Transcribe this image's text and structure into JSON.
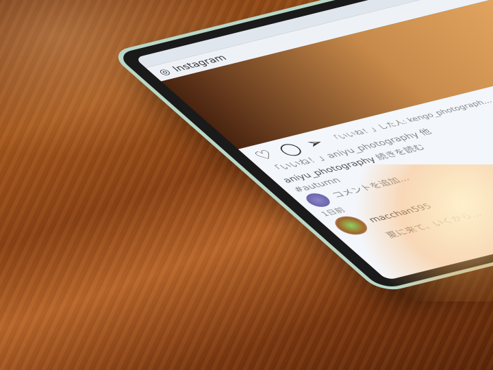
{
  "app": {
    "title": "Instagram"
  },
  "post": {
    "liked_by": "「いいね！」した人: kengo_photograph...",
    "liked_by_others": "「いいね！」aniyu_photography 他",
    "caption_user": "aniyu_photography",
    "read_more": "続きを読む",
    "hashtag": "#autumn",
    "add_comment_placeholder": "コメントを追加...",
    "timestamp": "1日前"
  },
  "next_post": {
    "username": "macchan595",
    "caption": "夏に来て、いくから..."
  }
}
